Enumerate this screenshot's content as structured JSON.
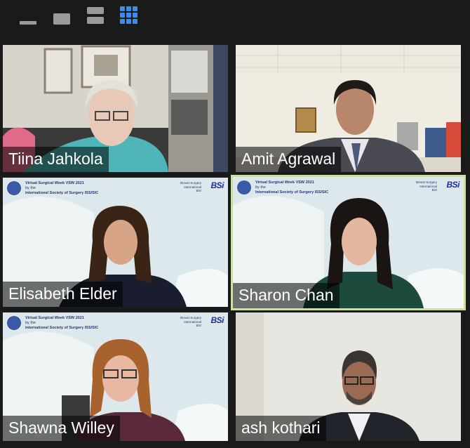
{
  "toolbar": {
    "buttons": [
      {
        "name": "minimize",
        "icon": "minimize-icon"
      },
      {
        "name": "speaker-view",
        "icon": "speaker-view-icon"
      },
      {
        "name": "stacked-view",
        "icon": "stacked-view-icon"
      },
      {
        "name": "gallery-view",
        "icon": "gallery-view-icon",
        "active": true
      }
    ],
    "active_color": "#3b8cf0"
  },
  "banner": {
    "title": "Virtual Surgical Week VSW 2021",
    "by": "by the",
    "org": "International Society of Surgery ISS/SIC",
    "right_lines": [
      "Breast Surgery",
      "International",
      "BSI"
    ],
    "logo": "BSi"
  },
  "participants": [
    {
      "name": "Tiina Jahkola",
      "background": "room"
    },
    {
      "name": "Amit Agrawal",
      "background": "office"
    },
    {
      "name": "Elisabeth Elder",
      "background": "banner"
    },
    {
      "name": "Sharon Chan",
      "background": "banner",
      "active_speaker": true,
      "highlight_color": "#c9e87a"
    },
    {
      "name": "Shawna Willey",
      "background": "banner"
    },
    {
      "name": "ash kothari",
      "background": "office"
    }
  ]
}
